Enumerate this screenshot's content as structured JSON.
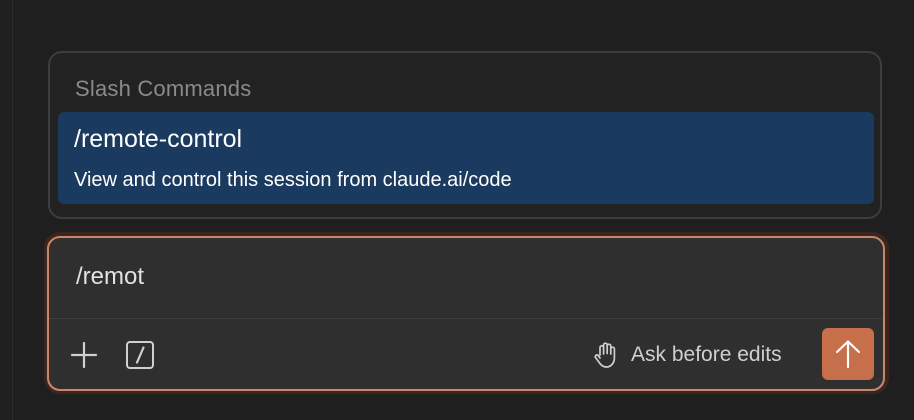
{
  "slash_popup": {
    "header": "Slash Commands",
    "items": [
      {
        "name": "/remote-control",
        "description": "View and control this session from claude.ai/code",
        "selected": true
      }
    ]
  },
  "composer": {
    "value": "/remot",
    "attach_icon": "plus-icon",
    "commands_icon": "slash-command-icon",
    "mode": {
      "icon": "hand-icon",
      "label": "Ask before edits"
    },
    "send_icon": "arrow-up-icon"
  },
  "colors": {
    "background": "#1f1f1f",
    "selected_item": "#1b3a5f",
    "accent": "#c76e4a",
    "input_border": "#c8876a"
  }
}
